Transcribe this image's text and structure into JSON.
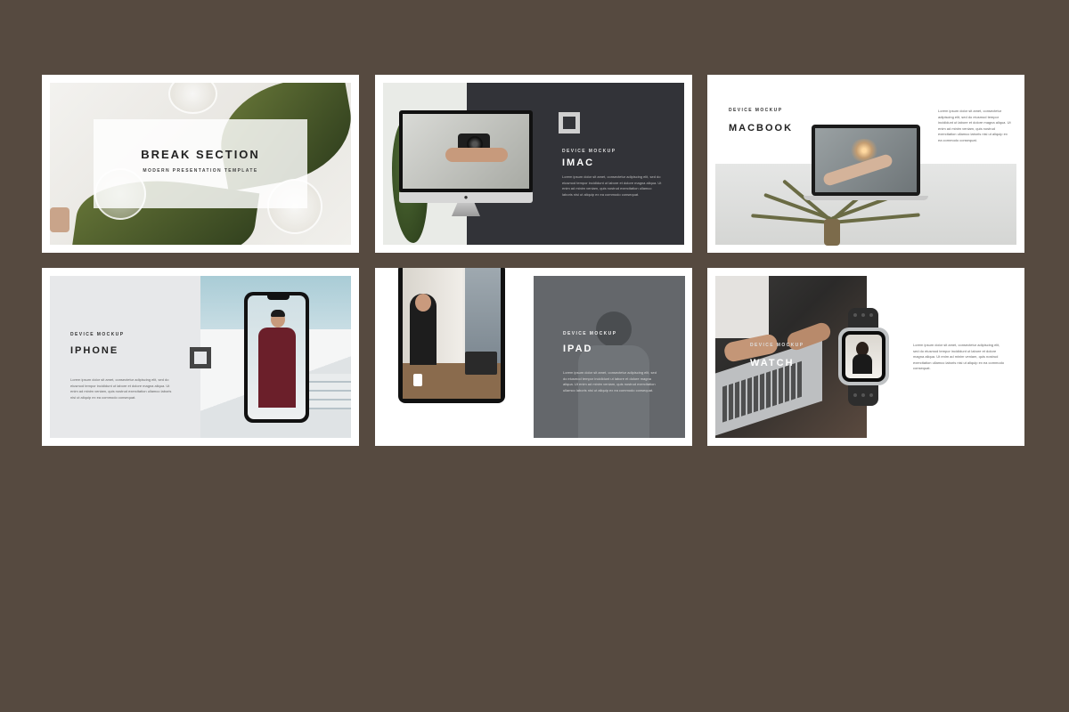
{
  "slides": [
    {
      "id": "break-section",
      "title": "BREAK SECTION",
      "subtitle": "MODERN PRESENTATION TEMPLATE"
    },
    {
      "id": "imac",
      "kicker": "DEVICE MOCKUP",
      "title": "IMAC",
      "body": "Lorem ipsum dolor sit amet, consectetur adipiscing elit, sed do eiusmod tempor incididunt ut labore et dolore magna aliqua. Ut enim ad minim veniam, quis nostrud exercitation ullamco laboris nisi ut aliquip ex ea commodo consequat."
    },
    {
      "id": "macbook",
      "kicker": "DEVICE MOCKUP",
      "title": "MACBOOK",
      "body": "Lorem ipsum dolor sit amet, consectetur adipiscing elit, sed do eiusmod tempor incididunt ut labore et dolore magna aliqua. Ut enim ad minim veniam, quis nostrud exercitation ullamco laboris nisi ut aliquip ex ea commodo consequat."
    },
    {
      "id": "iphone",
      "kicker": "DEVICE MOCKUP",
      "title": "IPHONE",
      "body": "Lorem ipsum dolor sit amet, consectetur adipiscing elit, sed do eiusmod tempor incididunt ut labore et dolore magna aliqua. Ut enim ad minim veniam, quis nostrud exercitation ullamco laboris nisi ut aliquip ex ea commodo consequat."
    },
    {
      "id": "ipad",
      "kicker": "DEVICE MOCKUP",
      "title": "IPAD",
      "body": "Lorem ipsum dolor sit amet, consectetur adipiscing elit, sed do eiusmod tempor incididunt ut labore et dolore magna aliqua. Ut enim ad minim veniam, quis nostrud exercitation ullamco laboris nisi ut aliquip ex ea commodo consequat."
    },
    {
      "id": "watch",
      "kicker": "DEVICE MOCKUP",
      "title": "WATCH",
      "body": "Lorem ipsum dolor sit amet, consectetur adipiscing elit, sed do eiusmod tempor incididunt ut labore et dolore magna aliqua. Ut enim ad minim veniam, quis nostrud exercitation ullamco laboris nisi ut aliquip ex ea commodo consequat."
    }
  ],
  "colors": {
    "background": "#564a40",
    "slide": "#ffffff",
    "dark_panel": "#323338",
    "gray_panel": "#64676b",
    "light_panel": "#e7e8ea"
  }
}
